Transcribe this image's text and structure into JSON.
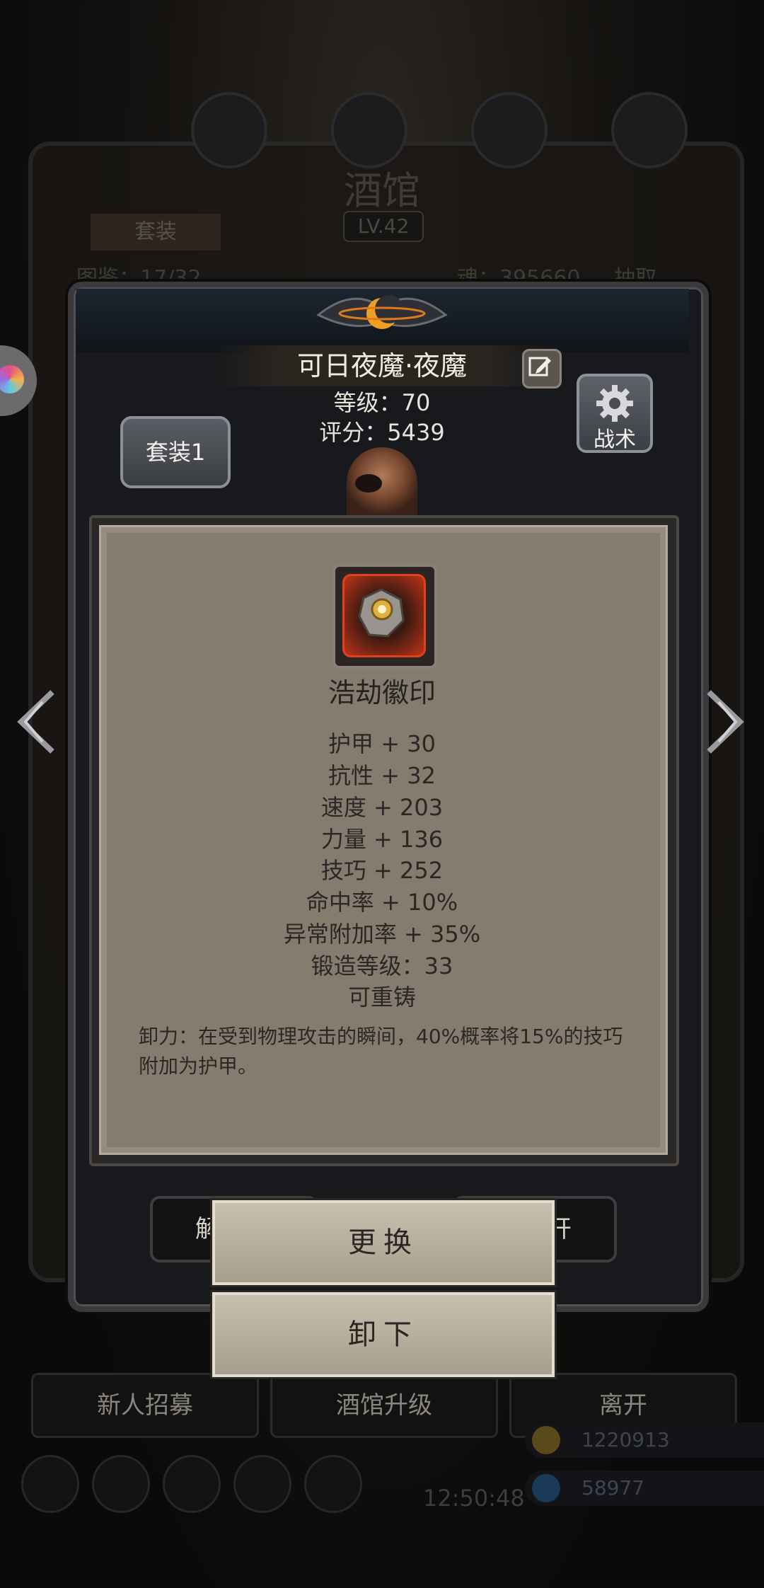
{
  "background": {
    "title": "酒馆",
    "level": "LV.42",
    "tab_suit": "套装",
    "collection_text": "图鉴：17/32",
    "soul_text": "魂：395660",
    "lock_text": "抽取",
    "bottom_buttons": [
      "新人招募",
      "酒馆升级",
      "离开"
    ],
    "clock": "12:50:48",
    "gold": "1220913",
    "gems": "58977",
    "hidden_buttons": [
      "解",
      "开"
    ]
  },
  "hero": {
    "name": "可日夜魔·夜魔",
    "level_label": "等级：70",
    "score_label": "评分：5439",
    "suit_button": "套装1",
    "tactics_button": "战术"
  },
  "item": {
    "name": "浩劫徽印",
    "attributes": [
      "护甲 + 30",
      "抗性 + 32",
      "速度 + 203",
      "力量 + 136",
      "技巧 + 252",
      "命中率 + 10%",
      "异常附加率 + 35%",
      "锻造等级：33",
      "可重铸"
    ],
    "description": "卸力：在受到物理攻击的瞬间，40%概率将15%的技巧附加为护甲。"
  },
  "actions": {
    "replace": "更换",
    "unequip": "卸下"
  },
  "colors": {
    "popup_bg": "#857c70",
    "slot_glow": "#e0401c",
    "button_bg": "#c9bfae"
  },
  "icons": [
    "edit-icon",
    "gear-icon",
    "arrow-left-icon",
    "arrow-right-icon",
    "seal-icon"
  ]
}
